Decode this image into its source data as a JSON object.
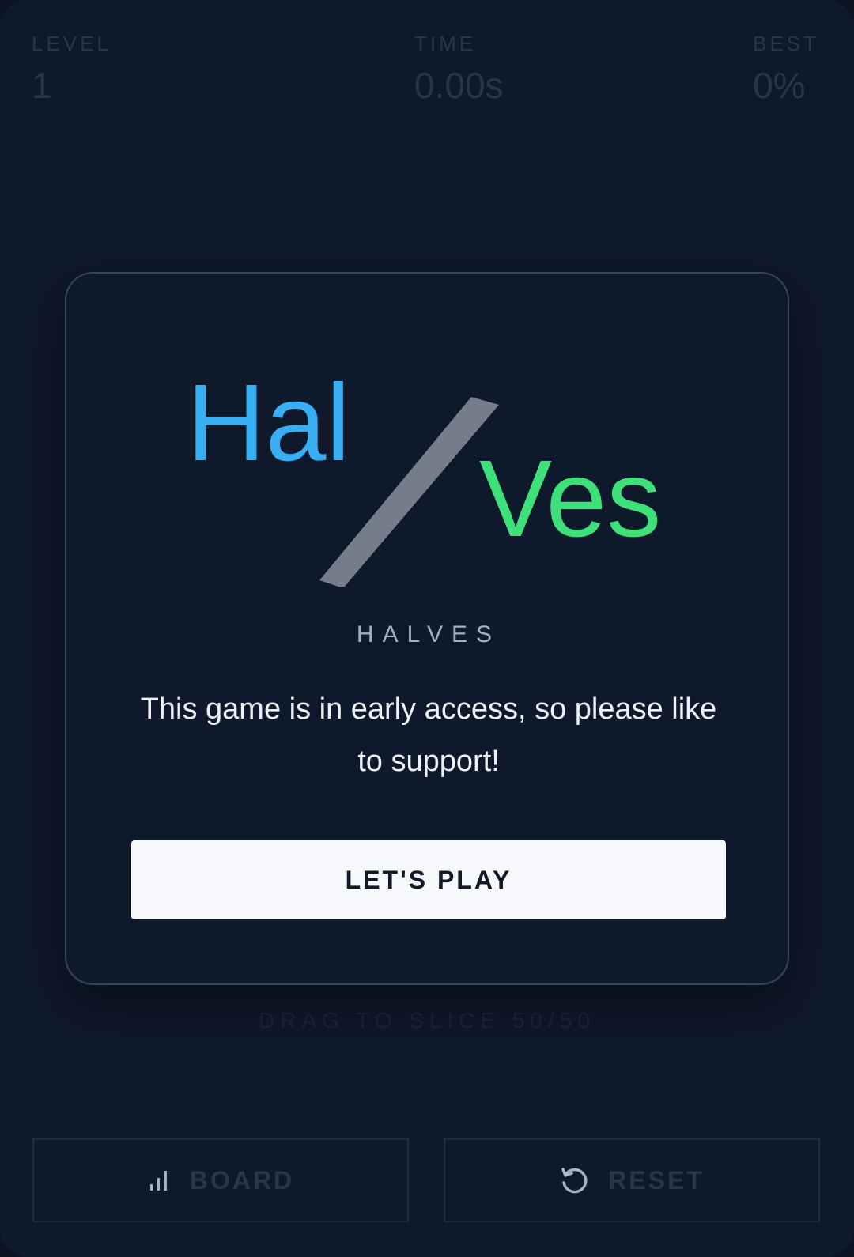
{
  "stats": {
    "level": {
      "label": "LEVEL",
      "value": "1"
    },
    "time": {
      "label": "TIME",
      "value": "0.00s"
    },
    "best": {
      "label": "BEST",
      "value": "0%"
    }
  },
  "hint": "DRAG TO SLICE 50/50",
  "bottom": {
    "board_label": "BOARD",
    "board_icon": "bar-chart-icon",
    "reset_label": "RESET",
    "reset_icon": "reset-icon"
  },
  "modal": {
    "logo_left": "Hal",
    "logo_right": "Ves",
    "subtitle": "HALVES",
    "message": "This game is in early access, so please like to support!",
    "play_label": "LET'S PLAY"
  },
  "colors": {
    "background": "#0f192c",
    "logo_left": "#38aef3",
    "logo_right": "#3ee07a",
    "slash": "#767c89",
    "button": "#f6f8fc"
  }
}
